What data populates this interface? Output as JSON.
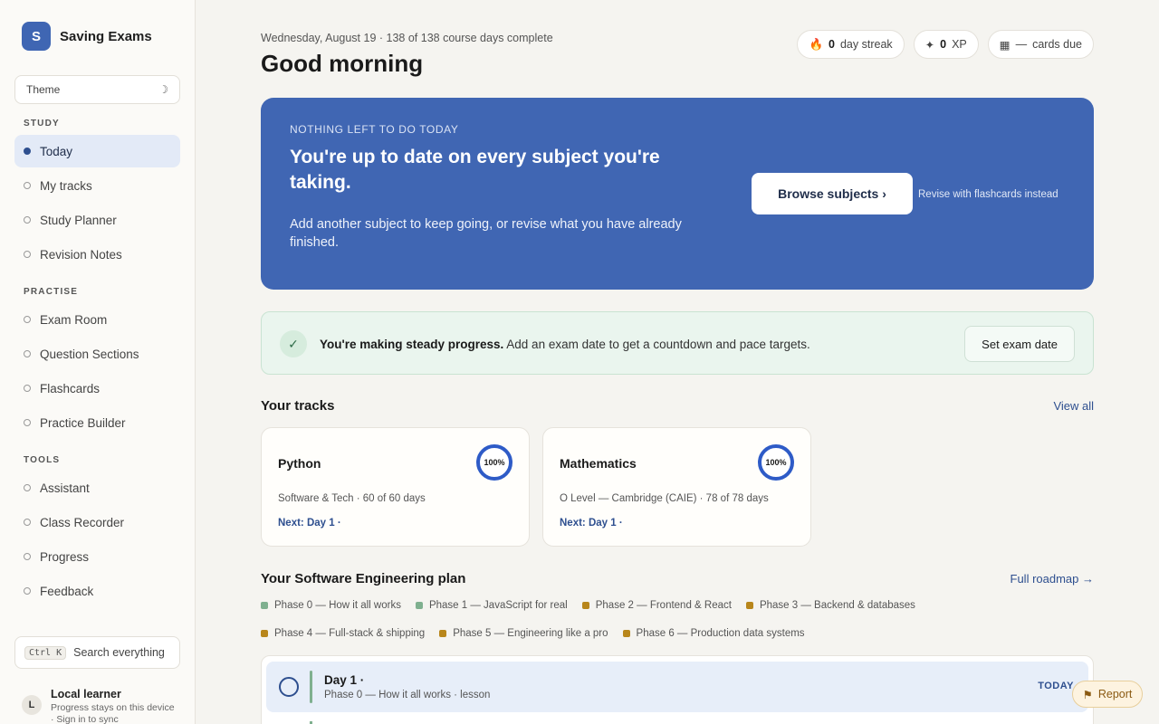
{
  "brand": {
    "logo_letter": "S",
    "name": "Saving Exams"
  },
  "theme": {
    "label": "Theme",
    "icon": "moon-icon"
  },
  "nav": {
    "study_heading": "STUDY",
    "study": [
      {
        "label": "Today",
        "active": true
      },
      {
        "label": "My tracks"
      },
      {
        "label": "Study Planner"
      },
      {
        "label": "Revision Notes"
      }
    ],
    "practise_heading": "PRACTISE",
    "practise": [
      {
        "label": "Exam Room"
      },
      {
        "label": "Question Sections"
      },
      {
        "label": "Flashcards"
      },
      {
        "label": "Practice Builder"
      }
    ],
    "tools_heading": "TOOLS",
    "tools": [
      {
        "label": "Assistant"
      },
      {
        "label": "Class Recorder"
      },
      {
        "label": "Progress"
      },
      {
        "label": "Feedback"
      }
    ]
  },
  "search": {
    "kbd": "Ctrl K",
    "label": "Search everything"
  },
  "user": {
    "initial": "L",
    "name": "Local learner",
    "sub": "Progress stays on this device · Sign in to sync"
  },
  "header": {
    "date_line": "Wednesday, August 19 · 138 of 138 course days complete",
    "greeting": "Good morning",
    "streak_value": "0",
    "streak_label": "day streak",
    "xp_value": "0",
    "xp_label": "XP",
    "cards_value": "—",
    "cards_label": "cards due"
  },
  "hero": {
    "eyebrow": "NOTHING LEFT TO DO TODAY",
    "title": "You're up to date on every subject you're taking.",
    "text": "Add another subject to keep going, or revise what you have already finished.",
    "button": "Browse subjects ›",
    "link": "Revise with flashcards instead"
  },
  "progress": {
    "bold": "You're making steady progress.",
    "text": " Add an exam date to get a countdown and pace targets.",
    "button": "Set exam date"
  },
  "tracks": {
    "title": "Your tracks",
    "view_all": "View all",
    "items": [
      {
        "name": "Python",
        "percent": "100%",
        "meta": "Software & Tech · 60 of 60 days",
        "next": "Next: Day 1 ·"
      },
      {
        "name": "Mathematics",
        "percent": "100%",
        "meta": "O Level — Cambridge (CAIE) · 78 of 78 days",
        "next": "Next: Day 1 ·"
      }
    ]
  },
  "plan": {
    "title": "Your Software Engineering plan",
    "roadmap": "Full roadmap →",
    "phases": [
      {
        "label": "Phase 0 — How it all works",
        "color": "#7fb08f"
      },
      {
        "label": "Phase 1 — JavaScript for real",
        "color": "#7fb08f"
      },
      {
        "label": "Phase 2 — Frontend & React",
        "color": "#b8861b"
      },
      {
        "label": "Phase 3 — Backend & databases",
        "color": "#b8861b"
      },
      {
        "label": "Phase 4 — Full-stack & shipping",
        "color": "#b8861b"
      },
      {
        "label": "Phase 5 — Engineering like a pro",
        "color": "#b8861b"
      },
      {
        "label": "Phase 6 — Production data systems",
        "color": "#b8861b"
      }
    ],
    "day": {
      "title": "Day 1 ·",
      "sub": "Phase 0 — How it all works · lesson",
      "badge": "TODAY"
    }
  },
  "report": {
    "label": "Report",
    "icon": "flag-icon"
  }
}
